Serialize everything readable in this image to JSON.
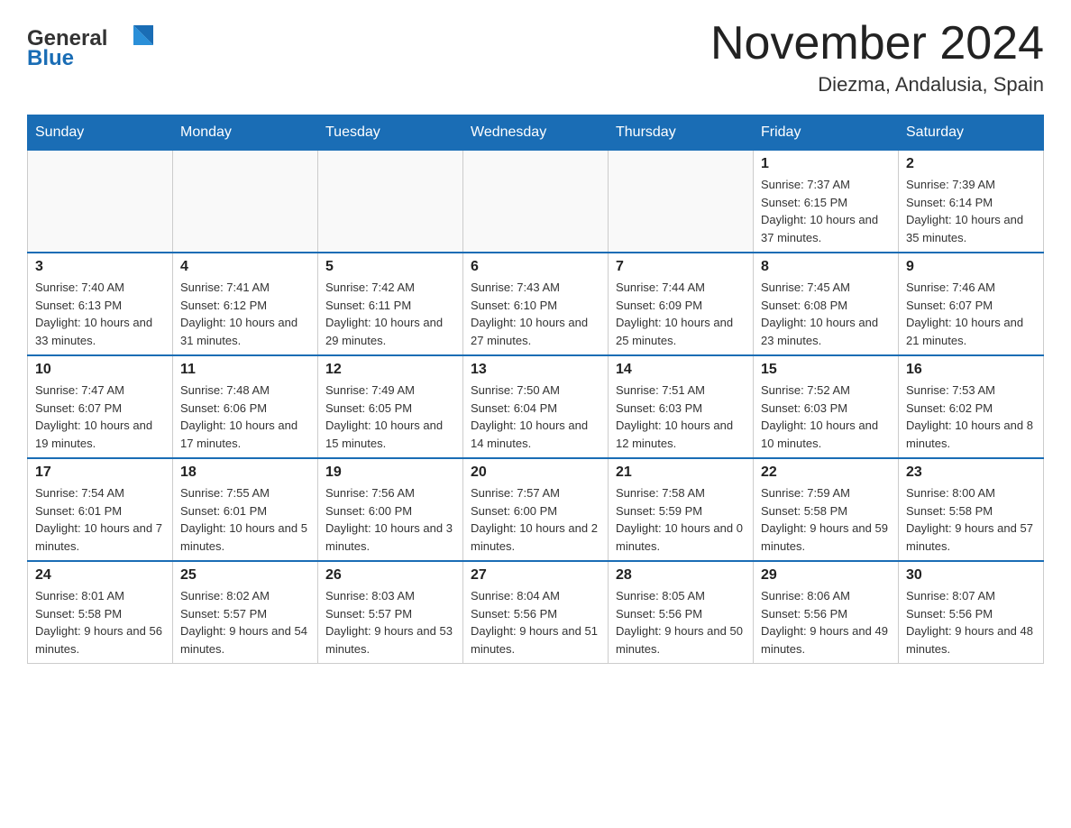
{
  "header": {
    "logo_text_main": "General",
    "logo_text_blue": "Blue",
    "month_title": "November 2024",
    "location": "Diezma, Andalusia, Spain"
  },
  "days_of_week": [
    "Sunday",
    "Monday",
    "Tuesday",
    "Wednesday",
    "Thursday",
    "Friday",
    "Saturday"
  ],
  "weeks": [
    [
      {
        "day": "",
        "sunrise": "",
        "sunset": "",
        "daylight": "",
        "empty": true
      },
      {
        "day": "",
        "sunrise": "",
        "sunset": "",
        "daylight": "",
        "empty": true
      },
      {
        "day": "",
        "sunrise": "",
        "sunset": "",
        "daylight": "",
        "empty": true
      },
      {
        "day": "",
        "sunrise": "",
        "sunset": "",
        "daylight": "",
        "empty": true
      },
      {
        "day": "",
        "sunrise": "",
        "sunset": "",
        "daylight": "",
        "empty": true
      },
      {
        "day": "1",
        "sunrise": "Sunrise: 7:37 AM",
        "sunset": "Sunset: 6:15 PM",
        "daylight": "Daylight: 10 hours and 37 minutes.",
        "empty": false
      },
      {
        "day": "2",
        "sunrise": "Sunrise: 7:39 AM",
        "sunset": "Sunset: 6:14 PM",
        "daylight": "Daylight: 10 hours and 35 minutes.",
        "empty": false
      }
    ],
    [
      {
        "day": "3",
        "sunrise": "Sunrise: 7:40 AM",
        "sunset": "Sunset: 6:13 PM",
        "daylight": "Daylight: 10 hours and 33 minutes.",
        "empty": false
      },
      {
        "day": "4",
        "sunrise": "Sunrise: 7:41 AM",
        "sunset": "Sunset: 6:12 PM",
        "daylight": "Daylight: 10 hours and 31 minutes.",
        "empty": false
      },
      {
        "day": "5",
        "sunrise": "Sunrise: 7:42 AM",
        "sunset": "Sunset: 6:11 PM",
        "daylight": "Daylight: 10 hours and 29 minutes.",
        "empty": false
      },
      {
        "day": "6",
        "sunrise": "Sunrise: 7:43 AM",
        "sunset": "Sunset: 6:10 PM",
        "daylight": "Daylight: 10 hours and 27 minutes.",
        "empty": false
      },
      {
        "day": "7",
        "sunrise": "Sunrise: 7:44 AM",
        "sunset": "Sunset: 6:09 PM",
        "daylight": "Daylight: 10 hours and 25 minutes.",
        "empty": false
      },
      {
        "day": "8",
        "sunrise": "Sunrise: 7:45 AM",
        "sunset": "Sunset: 6:08 PM",
        "daylight": "Daylight: 10 hours and 23 minutes.",
        "empty": false
      },
      {
        "day": "9",
        "sunrise": "Sunrise: 7:46 AM",
        "sunset": "Sunset: 6:07 PM",
        "daylight": "Daylight: 10 hours and 21 minutes.",
        "empty": false
      }
    ],
    [
      {
        "day": "10",
        "sunrise": "Sunrise: 7:47 AM",
        "sunset": "Sunset: 6:07 PM",
        "daylight": "Daylight: 10 hours and 19 minutes.",
        "empty": false
      },
      {
        "day": "11",
        "sunrise": "Sunrise: 7:48 AM",
        "sunset": "Sunset: 6:06 PM",
        "daylight": "Daylight: 10 hours and 17 minutes.",
        "empty": false
      },
      {
        "day": "12",
        "sunrise": "Sunrise: 7:49 AM",
        "sunset": "Sunset: 6:05 PM",
        "daylight": "Daylight: 10 hours and 15 minutes.",
        "empty": false
      },
      {
        "day": "13",
        "sunrise": "Sunrise: 7:50 AM",
        "sunset": "Sunset: 6:04 PM",
        "daylight": "Daylight: 10 hours and 14 minutes.",
        "empty": false
      },
      {
        "day": "14",
        "sunrise": "Sunrise: 7:51 AM",
        "sunset": "Sunset: 6:03 PM",
        "daylight": "Daylight: 10 hours and 12 minutes.",
        "empty": false
      },
      {
        "day": "15",
        "sunrise": "Sunrise: 7:52 AM",
        "sunset": "Sunset: 6:03 PM",
        "daylight": "Daylight: 10 hours and 10 minutes.",
        "empty": false
      },
      {
        "day": "16",
        "sunrise": "Sunrise: 7:53 AM",
        "sunset": "Sunset: 6:02 PM",
        "daylight": "Daylight: 10 hours and 8 minutes.",
        "empty": false
      }
    ],
    [
      {
        "day": "17",
        "sunrise": "Sunrise: 7:54 AM",
        "sunset": "Sunset: 6:01 PM",
        "daylight": "Daylight: 10 hours and 7 minutes.",
        "empty": false
      },
      {
        "day": "18",
        "sunrise": "Sunrise: 7:55 AM",
        "sunset": "Sunset: 6:01 PM",
        "daylight": "Daylight: 10 hours and 5 minutes.",
        "empty": false
      },
      {
        "day": "19",
        "sunrise": "Sunrise: 7:56 AM",
        "sunset": "Sunset: 6:00 PM",
        "daylight": "Daylight: 10 hours and 3 minutes.",
        "empty": false
      },
      {
        "day": "20",
        "sunrise": "Sunrise: 7:57 AM",
        "sunset": "Sunset: 6:00 PM",
        "daylight": "Daylight: 10 hours and 2 minutes.",
        "empty": false
      },
      {
        "day": "21",
        "sunrise": "Sunrise: 7:58 AM",
        "sunset": "Sunset: 5:59 PM",
        "daylight": "Daylight: 10 hours and 0 minutes.",
        "empty": false
      },
      {
        "day": "22",
        "sunrise": "Sunrise: 7:59 AM",
        "sunset": "Sunset: 5:58 PM",
        "daylight": "Daylight: 9 hours and 59 minutes.",
        "empty": false
      },
      {
        "day": "23",
        "sunrise": "Sunrise: 8:00 AM",
        "sunset": "Sunset: 5:58 PM",
        "daylight": "Daylight: 9 hours and 57 minutes.",
        "empty": false
      }
    ],
    [
      {
        "day": "24",
        "sunrise": "Sunrise: 8:01 AM",
        "sunset": "Sunset: 5:58 PM",
        "daylight": "Daylight: 9 hours and 56 minutes.",
        "empty": false
      },
      {
        "day": "25",
        "sunrise": "Sunrise: 8:02 AM",
        "sunset": "Sunset: 5:57 PM",
        "daylight": "Daylight: 9 hours and 54 minutes.",
        "empty": false
      },
      {
        "day": "26",
        "sunrise": "Sunrise: 8:03 AM",
        "sunset": "Sunset: 5:57 PM",
        "daylight": "Daylight: 9 hours and 53 minutes.",
        "empty": false
      },
      {
        "day": "27",
        "sunrise": "Sunrise: 8:04 AM",
        "sunset": "Sunset: 5:56 PM",
        "daylight": "Daylight: 9 hours and 51 minutes.",
        "empty": false
      },
      {
        "day": "28",
        "sunrise": "Sunrise: 8:05 AM",
        "sunset": "Sunset: 5:56 PM",
        "daylight": "Daylight: 9 hours and 50 minutes.",
        "empty": false
      },
      {
        "day": "29",
        "sunrise": "Sunrise: 8:06 AM",
        "sunset": "Sunset: 5:56 PM",
        "daylight": "Daylight: 9 hours and 49 minutes.",
        "empty": false
      },
      {
        "day": "30",
        "sunrise": "Sunrise: 8:07 AM",
        "sunset": "Sunset: 5:56 PM",
        "daylight": "Daylight: 9 hours and 48 minutes.",
        "empty": false
      }
    ]
  ]
}
